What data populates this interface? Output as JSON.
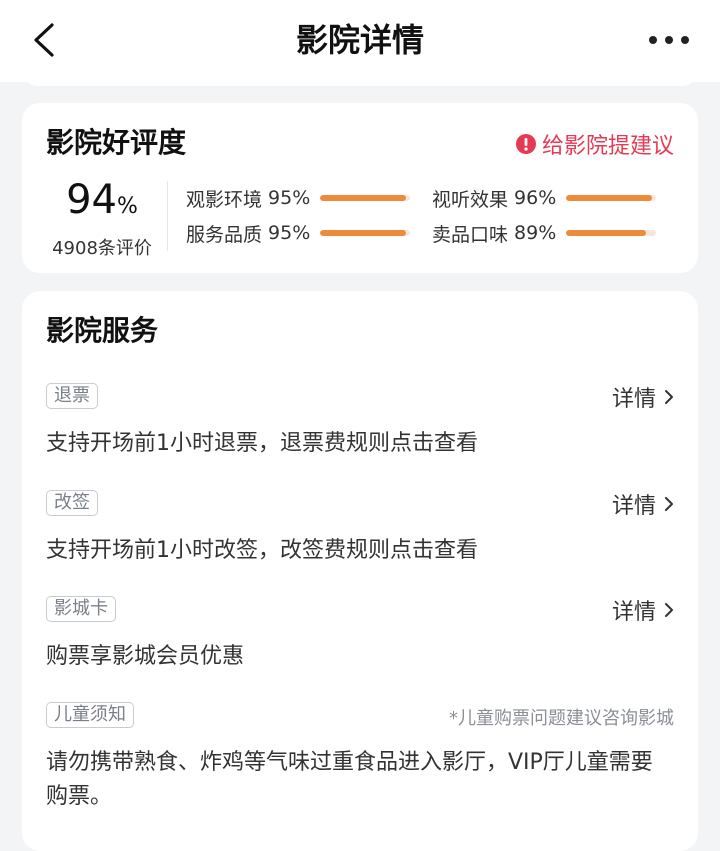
{
  "header": {
    "title": "影院详情"
  },
  "rating": {
    "title": "影院好评度",
    "suggest_label": "给影院提建议",
    "score": "94",
    "score_unit": "%",
    "review_count": "4908条评价",
    "metrics": [
      {
        "label": "观影环境",
        "value": "95%",
        "level": 0.95
      },
      {
        "label": "视听效果",
        "value": "96%",
        "level": 0.96
      },
      {
        "label": "服务品质",
        "value": "95%",
        "level": 0.95
      },
      {
        "label": "卖品口味",
        "value": "89%",
        "level": 0.89
      }
    ]
  },
  "services": {
    "title": "影院服务",
    "items": [
      {
        "tag": "退票",
        "detail": "详情",
        "desc": "支持开场前1小时退票，退票费规则点击查看"
      },
      {
        "tag": "改签",
        "detail": "详情",
        "desc": "支持开场前1小时改签，改签费规则点击查看"
      },
      {
        "tag": "影城卡",
        "detail": "详情",
        "desc": "购票享影城会员优惠"
      },
      {
        "tag": "儿童须知",
        "note": "*儿童购票问题建议咨询影城",
        "desc": "请勿携带熟食、炸鸡等气味过重食品进入影厅，VIP厅儿童需要购票。"
      }
    ]
  },
  "colors": {
    "accent_red": "#e53a53",
    "bar_orange": "#ee8b3a",
    "background": "#f3f4f6"
  },
  "icons": [
    "back-icon",
    "more-icon",
    "warning-icon",
    "chevron-right-icon"
  ]
}
